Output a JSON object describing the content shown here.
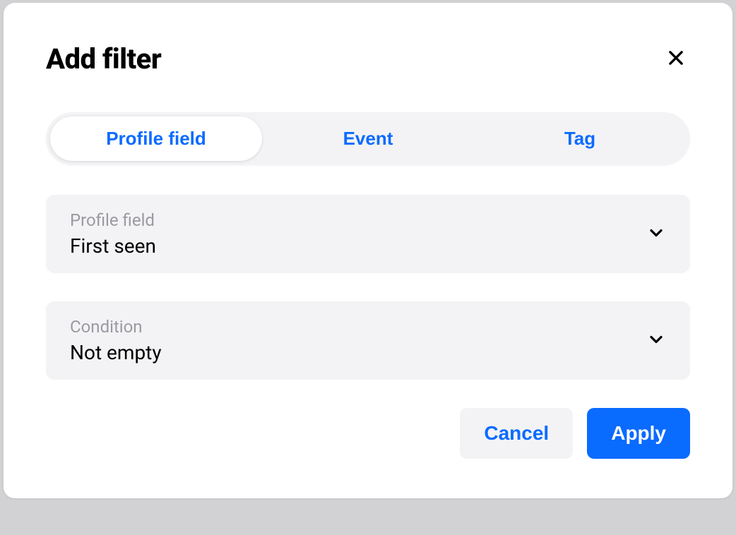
{
  "modal": {
    "title": "Add filter",
    "tabs": {
      "profile_field": "Profile field",
      "event": "Event",
      "tag": "Tag"
    },
    "fields": {
      "profile_field": {
        "label": "Profile field",
        "value": "First seen"
      },
      "condition": {
        "label": "Condition",
        "value": "Not empty"
      }
    },
    "buttons": {
      "cancel": "Cancel",
      "apply": "Apply"
    }
  }
}
